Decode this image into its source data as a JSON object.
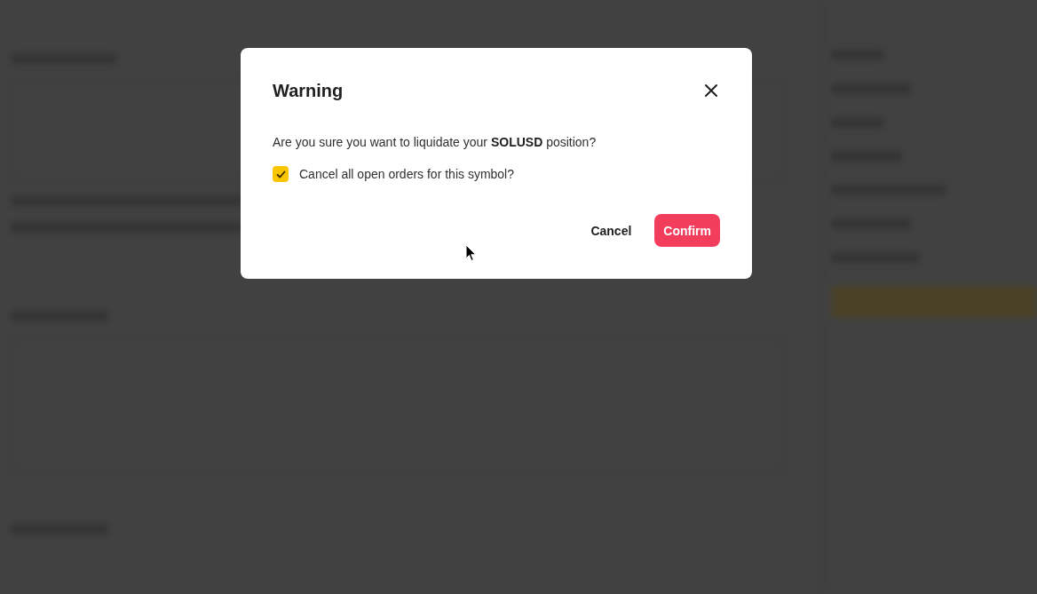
{
  "dialog": {
    "title": "Warning",
    "message": "Are you sure you want to liquidate your **SOLUSD** position?",
    "option": {
      "label": "Cancel all open orders for this symbol?",
      "checked": true
    },
    "buttons": [
      {
        "label": "Cancel",
        "kind": "text"
      },
      {
        "label": "Confirm",
        "kind": "primary"
      }
    ]
  }
}
